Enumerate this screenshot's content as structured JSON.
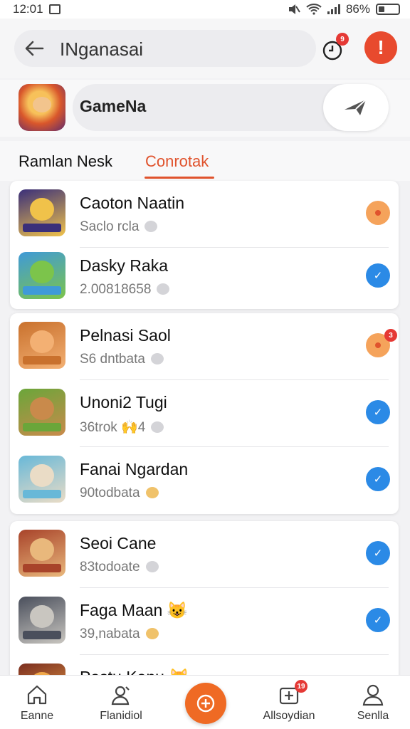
{
  "status_bar": {
    "time": "12:01",
    "battery": "86%"
  },
  "search": {
    "text": "INganasai",
    "history_badge": "9"
  },
  "app": {
    "name": "GameNa"
  },
  "tabs": [
    {
      "label": "Ramlan Nesk",
      "active": false
    },
    {
      "label": "Conrotak",
      "active": true
    }
  ],
  "groups": [
    {
      "items": [
        {
          "title": "Caoton Naatin",
          "subtitle": "Saclo rcla",
          "status": "orange",
          "icon_colors": [
            "#3a2f7a",
            "#f0c24a"
          ]
        },
        {
          "title": "Dasky Raka",
          "subtitle": "2.00818658",
          "status": "blue",
          "icon_colors": [
            "#3f9ad8",
            "#7cc44b"
          ]
        }
      ]
    },
    {
      "items": [
        {
          "title": "Pelnasi Saol",
          "subtitle": "S6 dntbata",
          "status": "orange",
          "badge": "3",
          "icon_colors": [
            "#c9712d",
            "#f3b073"
          ]
        },
        {
          "title": "Unoni2 Tugi",
          "subtitle": "36trok 🙌4",
          "status": "blue",
          "icon_colors": [
            "#6aa63a",
            "#c98a4b"
          ]
        },
        {
          "title": "Fanai Ngardan",
          "subtitle": "90todbata",
          "status": "blue",
          "icon_colors": [
            "#68b8d8",
            "#eadcc6"
          ]
        }
      ]
    },
    {
      "items": [
        {
          "title": "Seoi Cane",
          "subtitle": "83todoate",
          "status": "blue",
          "icon_colors": [
            "#a8432a",
            "#e9b87c"
          ]
        },
        {
          "title": "Faga Maan 😺",
          "subtitle": "39,nabata",
          "status": "blue",
          "icon_colors": [
            "#4a4f5c",
            "#c9c6c0"
          ]
        },
        {
          "title": "Pastu Kanu 😺",
          "subtitle": "",
          "status": "blue",
          "icon_colors": [
            "#7a2d1f",
            "#f0a84a"
          ]
        }
      ]
    }
  ],
  "bottom_nav": [
    {
      "label": "Eanne",
      "icon": "home-icon"
    },
    {
      "label": "Flanidiol",
      "icon": "profile-edit-icon"
    },
    {
      "label": "",
      "icon": "center-action-icon"
    },
    {
      "label": "Allsoydian",
      "icon": "inbox-icon",
      "badge": "19"
    },
    {
      "label": "Senlla",
      "icon": "user-icon"
    }
  ],
  "colors": {
    "accent": "#e0532d",
    "check_blue": "#2b8ae6",
    "pending_orange": "#f5a35b",
    "alert_red": "#e84a2e"
  }
}
